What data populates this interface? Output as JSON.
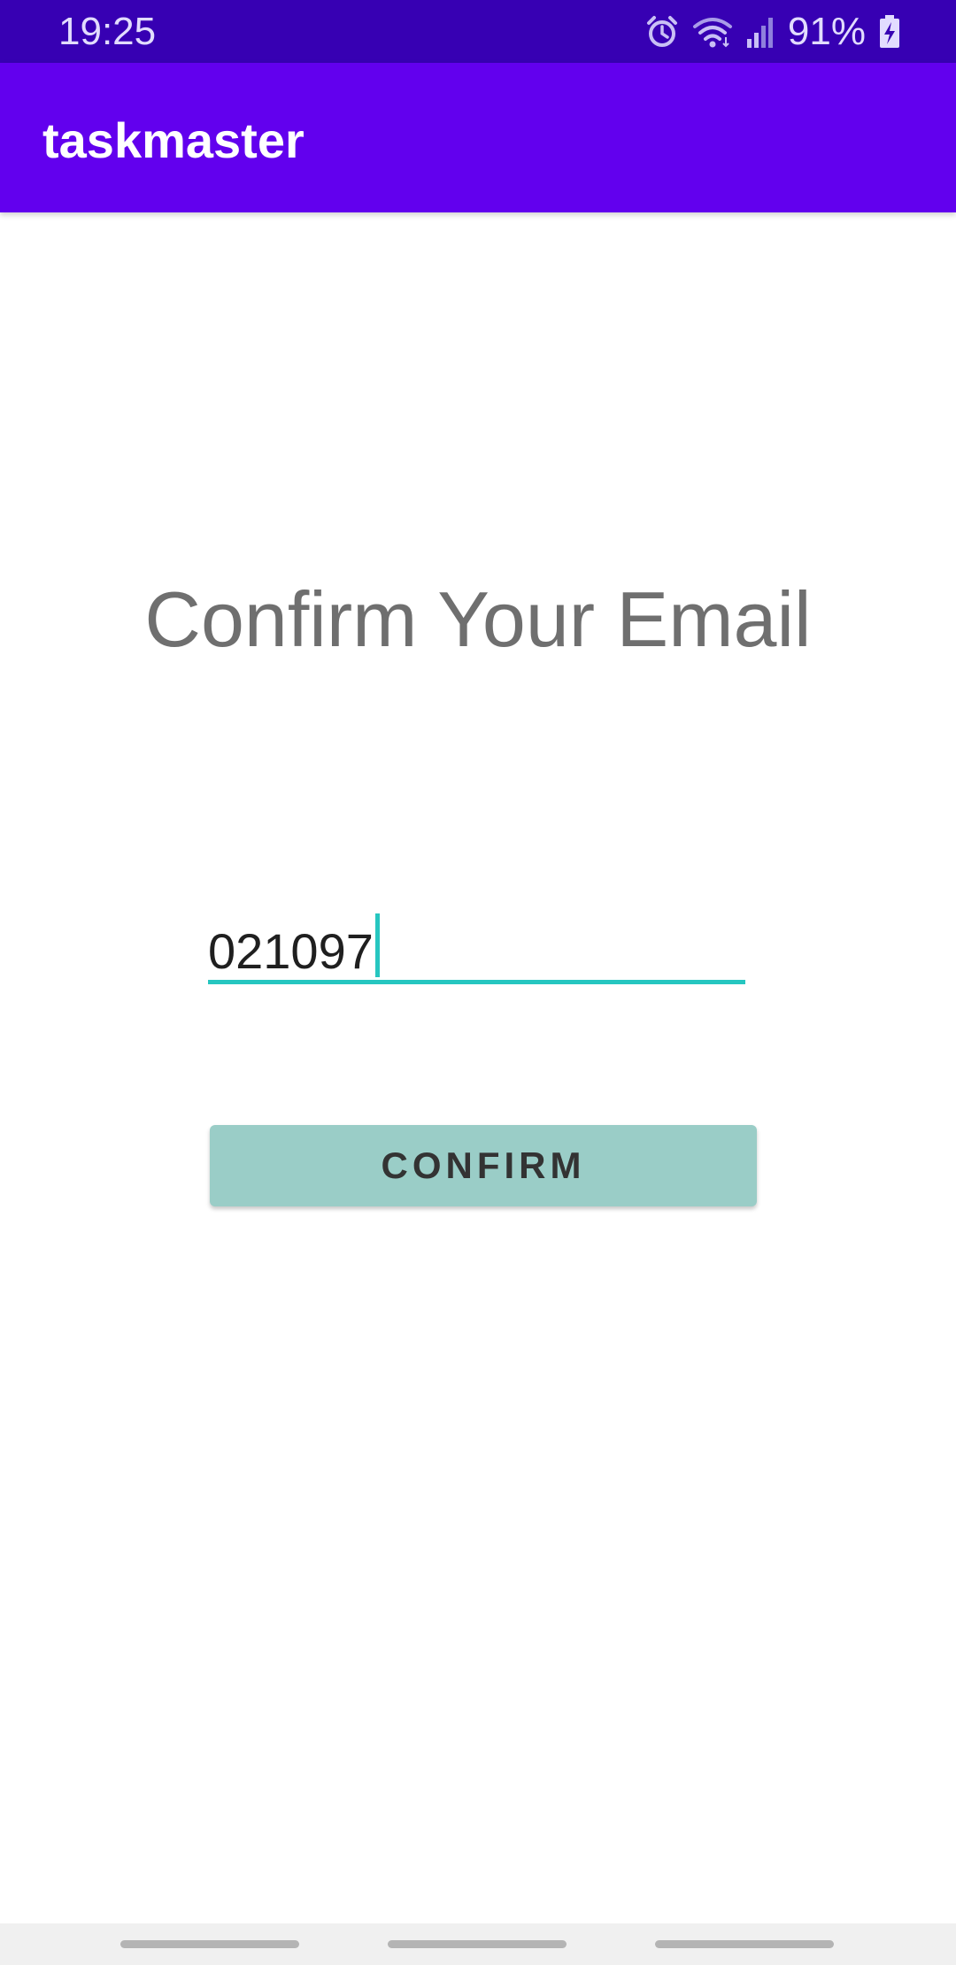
{
  "status_bar": {
    "time": "19:25",
    "battery_percent": "91%",
    "icons": [
      "alarm-icon",
      "wifi-icon",
      "signal-icon",
      "battery-charging-icon"
    ]
  },
  "app_bar": {
    "title": "taskmaster"
  },
  "main": {
    "heading": "Confirm Your Email",
    "code_field": {
      "value": "021097"
    },
    "confirm_button": {
      "label": "CONFIRM"
    }
  },
  "nav_bar": {
    "handles": [
      "nav-handle-left",
      "nav-handle-center",
      "nav-handle-right"
    ]
  },
  "colors": {
    "status_bar": "#3700b3",
    "app_bar": "#6200ee",
    "accent": "#26c6c0",
    "button": "#9acdc7"
  }
}
